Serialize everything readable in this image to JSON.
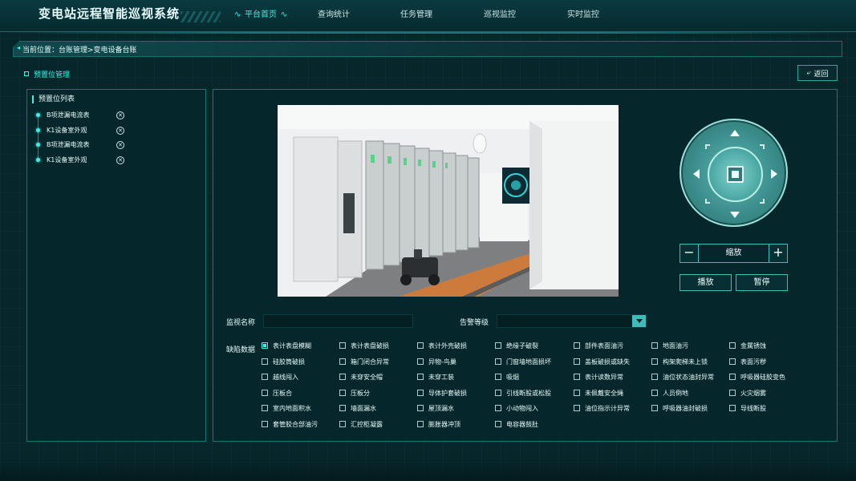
{
  "app": {
    "title": "变电站远程智能巡视系统"
  },
  "nav": [
    "平台首页",
    "查询统计",
    "任务管理",
    "巡视监控",
    "实时监控"
  ],
  "breadcrumb": {
    "text": "当前位置：台账管理>变电设备台账"
  },
  "section": {
    "title": "预置位管理"
  },
  "back_button": {
    "label": "返回"
  },
  "preset_list": {
    "title": "预置位列表",
    "items": [
      "B项泄漏电流表",
      "K1设备室外观",
      "B项泄漏电流表",
      "K1设备室外观"
    ]
  },
  "ptz": {
    "zoom_label": "缩放",
    "play_label": "播放",
    "pause_label": "暂停"
  },
  "form": {
    "monitor_name_label": "监视名称",
    "monitor_name_value": "",
    "alarm_level_label": "告警等级",
    "alarm_level_value": "",
    "defect_label": "缺陷数据"
  },
  "defects": [
    [
      {
        "label": "表计表盘模糊",
        "checked": true
      },
      {
        "label": "表计表盘破损",
        "checked": false
      },
      {
        "label": "表计外壳破损",
        "checked": false
      },
      {
        "label": "绝缘子破裂",
        "checked": false
      },
      {
        "label": "部件表面油污",
        "checked": false
      },
      {
        "label": "地面油污",
        "checked": false
      },
      {
        "label": "金属锈蚀",
        "checked": false
      }
    ],
    [
      {
        "label": "硅胶筒破损",
        "checked": false
      },
      {
        "label": "箱门闭合异常",
        "checked": false
      },
      {
        "label": "异物-鸟巢",
        "checked": false
      },
      {
        "label": "门窗墙地面损坏",
        "checked": false
      },
      {
        "label": "盖板破损或缺失",
        "checked": false
      },
      {
        "label": "构架爬梯未上锁",
        "checked": false
      },
      {
        "label": "表面污秽",
        "checked": false
      }
    ],
    [
      {
        "label": "越线闯入",
        "checked": false
      },
      {
        "label": "未穿安全帽",
        "checked": false
      },
      {
        "label": "未穿工装",
        "checked": false
      },
      {
        "label": "吸烟",
        "checked": false
      },
      {
        "label": "表计读数异常",
        "checked": false
      },
      {
        "label": "油位状态油封异常",
        "checked": false
      },
      {
        "label": "呼吸器硅胶变色",
        "checked": false
      }
    ],
    [
      {
        "label": "压板合",
        "checked": false
      },
      {
        "label": "压板分",
        "checked": false
      },
      {
        "label": "导体护套破损",
        "checked": false
      },
      {
        "label": "引线断股或松股",
        "checked": false
      },
      {
        "label": "未佩戴安全绳",
        "checked": false
      },
      {
        "label": "人员倒地",
        "checked": false
      },
      {
        "label": "火灾烟雾",
        "checked": false
      }
    ],
    [
      {
        "label": "室内地面积水",
        "checked": false
      },
      {
        "label": "墙面漏水",
        "checked": false
      },
      {
        "label": "屋顶漏水",
        "checked": false
      },
      {
        "label": "小动物闯入",
        "checked": false
      },
      {
        "label": "油位指示计异常",
        "checked": false
      },
      {
        "label": "呼吸器油封破损",
        "checked": false
      },
      {
        "label": "导线断股",
        "checked": false
      }
    ],
    [
      {
        "label": "套管胶合部油污",
        "checked": false
      },
      {
        "label": "汇控柜凝露",
        "checked": false
      },
      {
        "label": "膨胀器冲顶",
        "checked": false
      },
      {
        "label": "电容器鼓肚",
        "checked": false
      }
    ]
  ],
  "colors": {
    "accent": "#3ff0e4",
    "panel_border": "#1e7375",
    "background": "#06262a"
  }
}
